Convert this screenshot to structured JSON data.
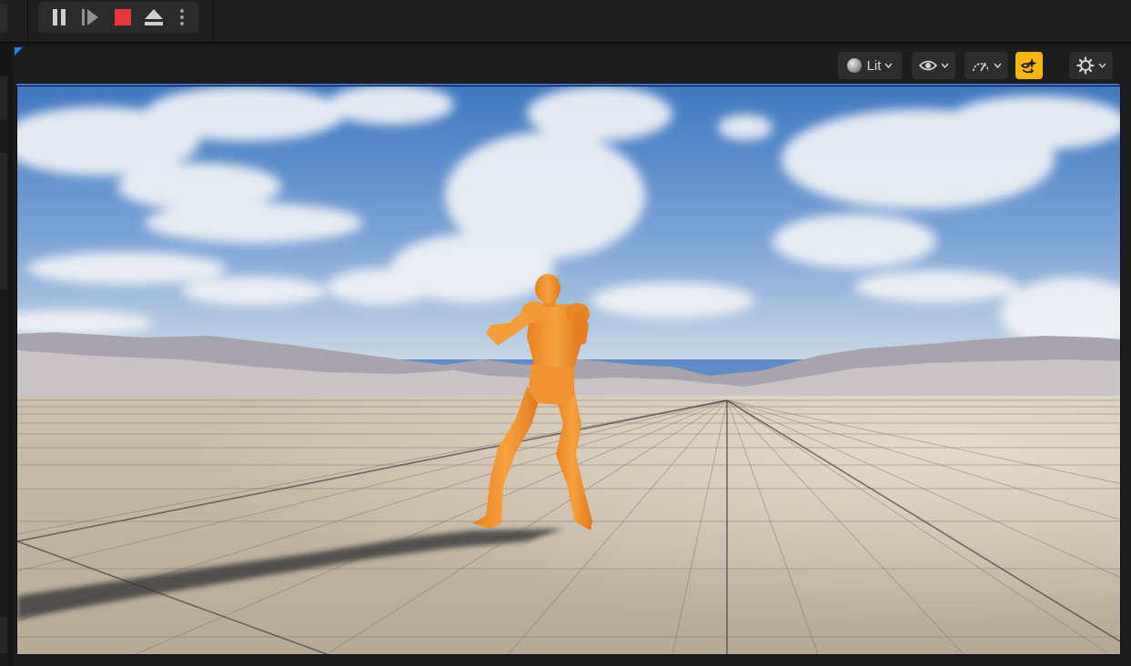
{
  "toolbar": {
    "play_controls": [
      {
        "id": "pause",
        "icon": "pause-icon"
      },
      {
        "id": "frame-advance",
        "icon": "frame-advance-icon"
      },
      {
        "id": "stop",
        "icon": "stop-icon",
        "color": "#e8383b"
      },
      {
        "id": "eject",
        "icon": "eject-icon"
      },
      {
        "id": "more",
        "icon": "vertical-ellipsis-icon"
      }
    ]
  },
  "viewport": {
    "view_mode_label": "Lit",
    "buttons": [
      {
        "id": "view-mode",
        "icon": "lit-sphere-icon",
        "label": "Lit",
        "dropdown": true
      },
      {
        "id": "show",
        "icon": "eye-icon",
        "dropdown": true
      },
      {
        "id": "performance",
        "icon": "gauge-icon",
        "dropdown": true
      },
      {
        "id": "realtime",
        "icon": "realtime-sparkle-icon",
        "active": true,
        "color": "#f5b70c"
      },
      {
        "id": "settings",
        "icon": "gear-icon",
        "dropdown": true
      }
    ],
    "scene": {
      "character_color": "#f3922a",
      "sky_color": "#4f86c9",
      "floor_color": "#cfc3b0"
    }
  }
}
